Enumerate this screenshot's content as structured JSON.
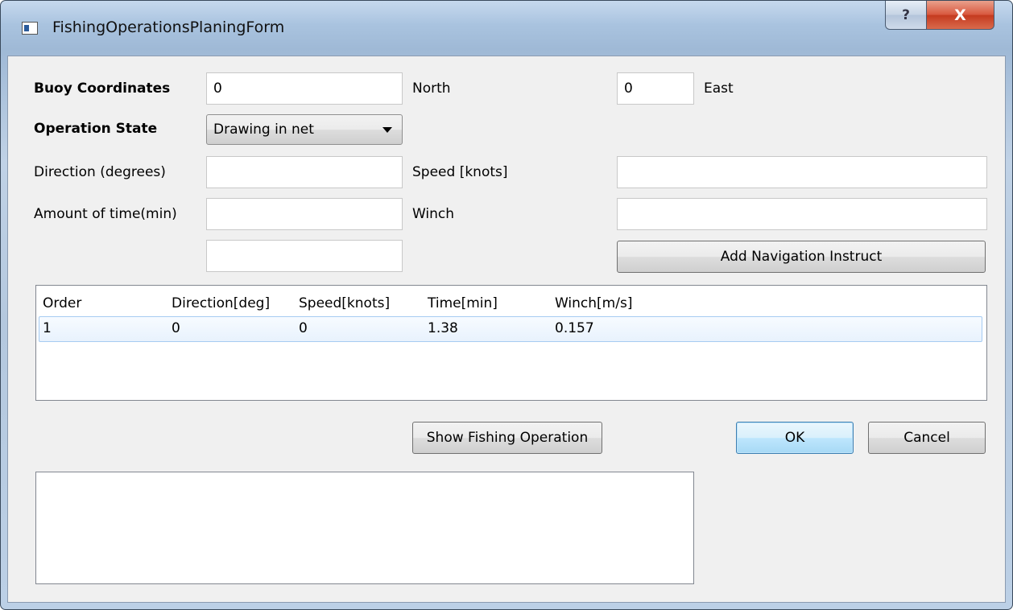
{
  "window": {
    "title": "FishingOperationsPlaningForm",
    "help_label": "?",
    "close_label": "X"
  },
  "form": {
    "buoy_label": "Buoy Coordinates",
    "north_value": "0",
    "north_label": "North",
    "east_value": "0",
    "east_label": "East",
    "state_label": "Operation State",
    "state_selected": "Drawing in net",
    "direction_label": "Direction (degrees)",
    "direction_value": "",
    "speed_label": "Speed [knots]",
    "speed_value": "",
    "time_label": "Amount of time(min)",
    "time_value": "",
    "winch_label": "Winch",
    "winch_value": "",
    "extra_value": "",
    "add_button": "Add Navigation Instruct"
  },
  "list": {
    "columns": [
      "Order",
      "Direction[deg]",
      "Speed[knots]",
      "Time[min]",
      "Winch[m/s]"
    ],
    "rows": [
      [
        "1",
        "0",
        "0",
        "1.38",
        "0.157"
      ]
    ]
  },
  "buttons": {
    "show": "Show Fishing Operation",
    "ok": "OK",
    "cancel": "Cancel"
  },
  "output_text": ""
}
